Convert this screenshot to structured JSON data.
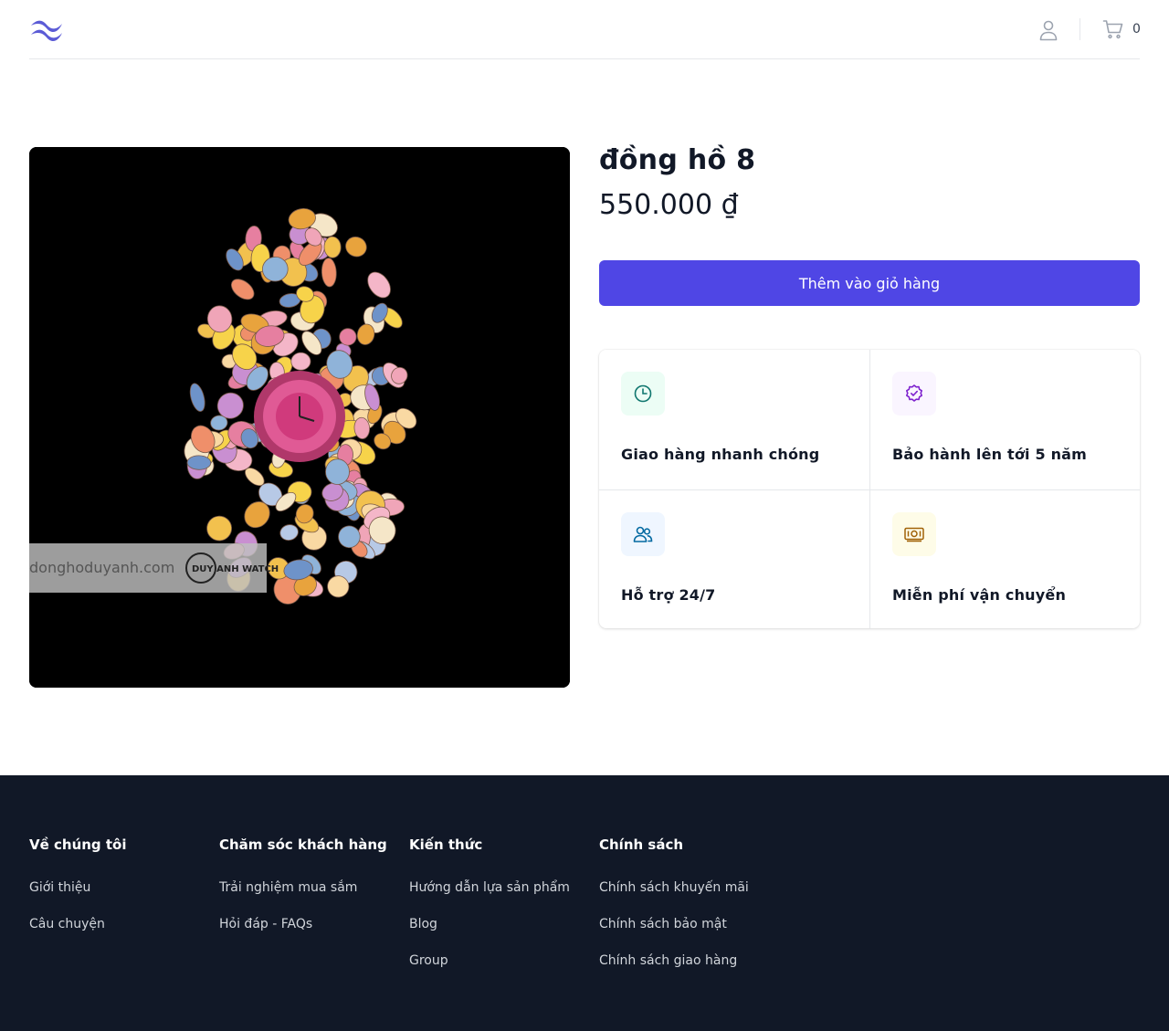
{
  "header": {
    "logo_icon": "wave-logo-icon",
    "account_icon": "user-icon",
    "cart_icon": "cart-icon",
    "cart_count": "0"
  },
  "product": {
    "title": "đồng hồ 8",
    "price": "550.000 ₫",
    "add_to_cart_label": "Thêm vào giỏ hàng",
    "image_watermark_text": "donghoduyanh.com",
    "image_logo_text": "DUY ANH WATCH"
  },
  "features": [
    {
      "label": "Giao hàng nhanh chóng",
      "icon": "clock-icon",
      "color": "#0f766e",
      "bg": "#ecfdf5"
    },
    {
      "label": "Bảo hành lên tới 5 năm",
      "icon": "badge-check-icon",
      "color": "#7e22ce",
      "bg": "#faf5ff"
    },
    {
      "label": "Hỗ trợ 24/7",
      "icon": "users-icon",
      "color": "#0369a1",
      "bg": "#eff6ff"
    },
    {
      "label": "Miễn phí vận chuyển",
      "icon": "money-icon",
      "color": "#a16207",
      "bg": "#fefce8"
    }
  ],
  "footer": {
    "columns": [
      {
        "title": "Về chúng tôi",
        "links": [
          "Giới thiệu",
          "Câu chuyện"
        ]
      },
      {
        "title": "Chăm sóc khách hàng",
        "links": [
          "Trải nghiệm mua sắm",
          "Hỏi đáp - FAQs"
        ]
      },
      {
        "title": "Kiến thức",
        "links": [
          "Hướng dẫn lựa sản phẩm",
          "Blog",
          "Group"
        ]
      },
      {
        "title": "Chính sách",
        "links": [
          "Chính sách khuyến mãi",
          "Chính sách bảo mật",
          "Chính sách giao hàng"
        ]
      }
    ]
  },
  "colors": {
    "primary": "#4f46e5",
    "footer_bg": "#111827",
    "logo": "#5b5bd6"
  }
}
